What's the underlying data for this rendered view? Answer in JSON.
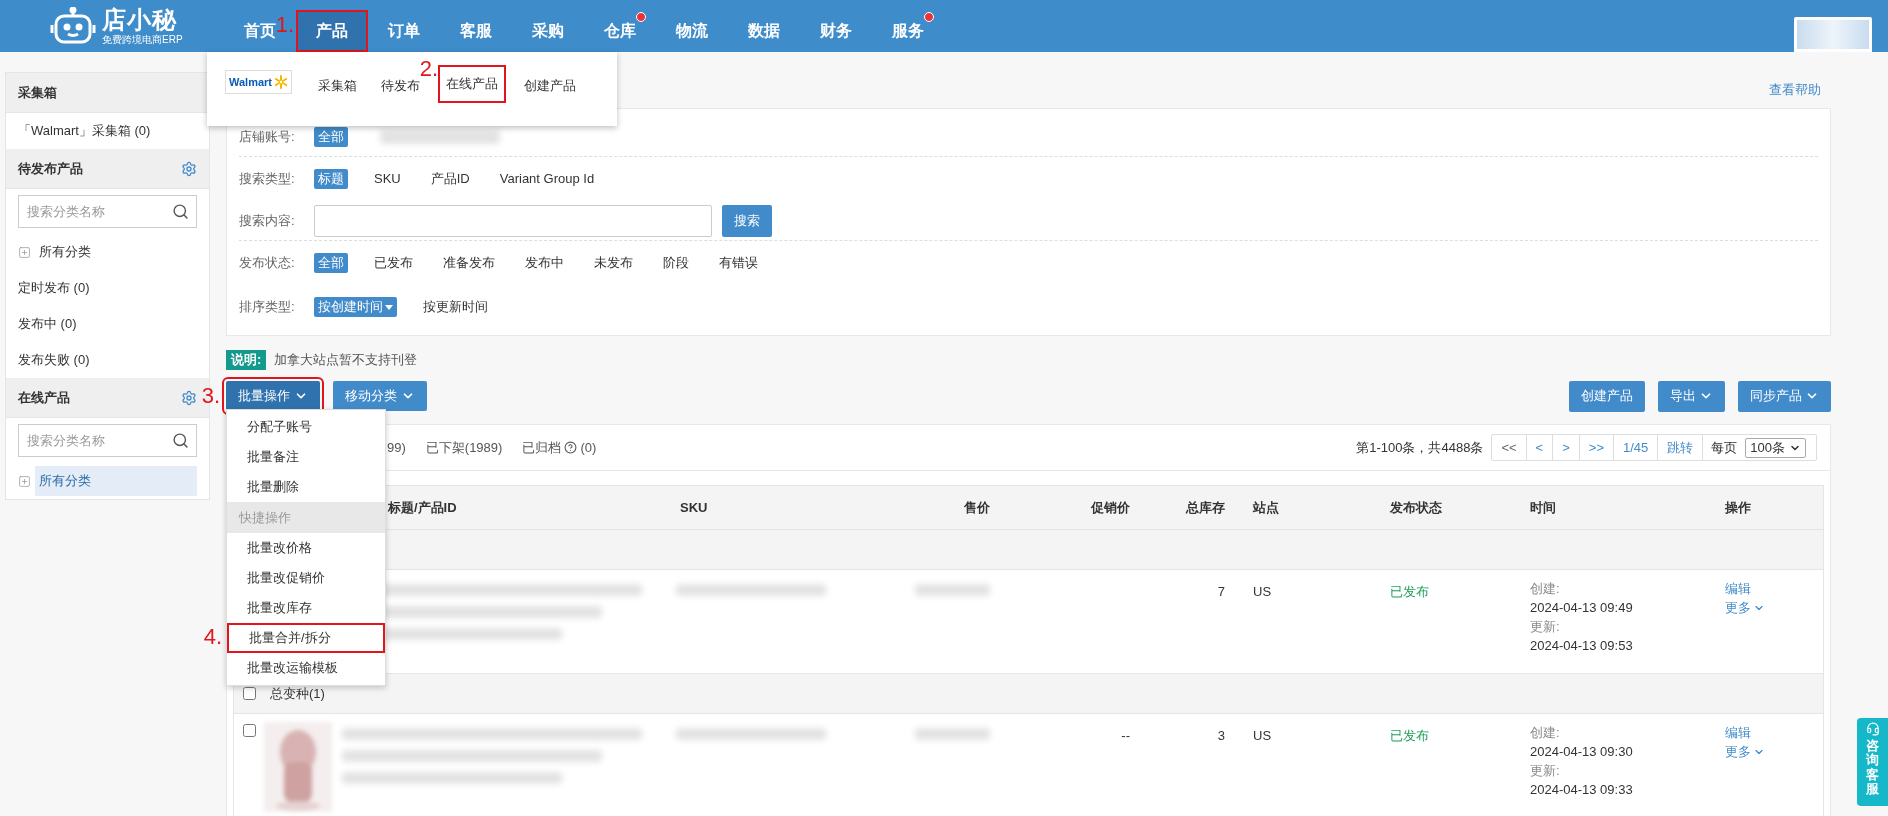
{
  "header": {
    "logo": {
      "name": "店小秘",
      "tagline": "免费跨境电商ERP"
    },
    "nav": [
      {
        "label": "首页",
        "selected": false,
        "badge": false,
        "highlighted": false
      },
      {
        "label": "产品",
        "selected": true,
        "badge": false,
        "highlighted": true,
        "annotation": "1."
      },
      {
        "label": "订单",
        "selected": false,
        "badge": false,
        "highlighted": false
      },
      {
        "label": "客服",
        "selected": false,
        "badge": false,
        "highlighted": false
      },
      {
        "label": "采购",
        "selected": false,
        "badge": false,
        "highlighted": false
      },
      {
        "label": "仓库",
        "selected": false,
        "badge": true,
        "highlighted": false
      },
      {
        "label": "物流",
        "selected": false,
        "badge": false,
        "highlighted": false
      },
      {
        "label": "数据",
        "selected": false,
        "badge": false,
        "highlighted": false
      },
      {
        "label": "财务",
        "selected": false,
        "badge": false,
        "highlighted": false
      },
      {
        "label": "服务",
        "selected": false,
        "badge": true,
        "highlighted": false
      }
    ]
  },
  "product_menu": {
    "brand": "Walmart",
    "items": [
      {
        "label": "采集箱",
        "highlighted": false
      },
      {
        "label": "待发布",
        "highlighted": false
      },
      {
        "label": "在线产品",
        "highlighted": true,
        "annotation": "2."
      },
      {
        "label": "创建产品",
        "highlighted": false
      }
    ]
  },
  "sidebar": {
    "sections": [
      {
        "title": "采集箱",
        "settings": false,
        "items": [
          {
            "kind": "link",
            "label": "「Walmart」采集箱 (0)",
            "selected": false
          }
        ]
      },
      {
        "title": "待发布产品",
        "settings": true,
        "items": [
          {
            "kind": "search",
            "placeholder": "搜索分类名称"
          },
          {
            "kind": "tree",
            "label": "所有分类",
            "selected": false
          },
          {
            "kind": "link",
            "label": "定时发布 (0)",
            "selected": false
          },
          {
            "kind": "link",
            "label": "发布中 (0)",
            "selected": false
          },
          {
            "kind": "link",
            "label": "发布失败 (0)",
            "selected": false
          }
        ]
      },
      {
        "title": "在线产品",
        "settings": true,
        "items": [
          {
            "kind": "search",
            "placeholder": "搜索分类名称"
          },
          {
            "kind": "tree",
            "label": "所有分类",
            "selected": true
          }
        ]
      }
    ]
  },
  "help_link": "查看帮助",
  "filters": [
    {
      "kind": "options",
      "label": "店铺账号:",
      "options": [
        {
          "label": "全部",
          "selected": true
        }
      ]
    },
    {
      "kind": "options",
      "label": "搜索类型:",
      "options": [
        {
          "label": "标题",
          "selected": true
        },
        {
          "label": "SKU",
          "selected": false
        },
        {
          "label": "产品ID",
          "selected": false
        },
        {
          "label": "Variant Group Id",
          "selected": false
        }
      ]
    },
    {
      "kind": "input",
      "label": "搜索内容:",
      "button": "搜索"
    },
    {
      "kind": "options",
      "label": "发布状态:",
      "options": [
        {
          "label": "全部",
          "selected": true
        },
        {
          "label": "已发布",
          "selected": false
        },
        {
          "label": "准备发布",
          "selected": false
        },
        {
          "label": "发布中",
          "selected": false
        },
        {
          "label": "未发布",
          "selected": false
        },
        {
          "label": "阶段",
          "selected": false
        },
        {
          "label": "有错误",
          "selected": false
        }
      ]
    },
    {
      "kind": "options",
      "label": "排序类型:",
      "options": [
        {
          "label": "按创建时间",
          "selected": true,
          "dropdown": true
        },
        {
          "label": "按更新时间",
          "selected": false,
          "dropdown": false
        }
      ]
    }
  ],
  "notice": {
    "tag": "说明:",
    "text": "加拿大站点暂不支持刊登"
  },
  "toolbar": {
    "left": [
      {
        "label": "批量操作",
        "highlighted": true,
        "annotation": "3.",
        "caret": true
      },
      {
        "label": "移动分类",
        "highlighted": false,
        "caret": true
      }
    ],
    "right": [
      {
        "label": "创建产品",
        "caret": false
      },
      {
        "label": "导出",
        "caret": true
      },
      {
        "label": "同步产品",
        "caret": true
      }
    ]
  },
  "batch_menu": {
    "items": [
      {
        "kind": "item",
        "label": "分配子账号",
        "highlighted": false
      },
      {
        "kind": "item",
        "label": "批量备注",
        "highlighted": false
      },
      {
        "kind": "item",
        "label": "批量删除",
        "highlighted": false
      },
      {
        "kind": "header",
        "label": "快捷操作"
      },
      {
        "kind": "item",
        "label": "批量改价格",
        "highlighted": false
      },
      {
        "kind": "item",
        "label": "批量改促销价",
        "highlighted": false
      },
      {
        "kind": "item",
        "label": "批量改库存",
        "highlighted": false
      },
      {
        "kind": "item",
        "label": "批量合并/拆分",
        "highlighted": true,
        "annotation": "4."
      },
      {
        "kind": "item",
        "label": "批量改运输模板",
        "highlighted": false
      }
    ]
  },
  "tabs": [
    {
      "label": "99)",
      "help": false,
      "selected": false
    },
    {
      "label": "已下架(1989)",
      "help": false,
      "selected": false
    },
    {
      "label": "已归档",
      "help": true,
      "count": "(0)",
      "selected": false
    }
  ],
  "pagination": {
    "summary": "第1-100条，共4488条",
    "buttons": [
      "<<",
      "<",
      ">",
      ">>",
      "1/45",
      "跳转"
    ],
    "per_page_label": "每页",
    "per_page": "100条"
  },
  "table": {
    "columns": [
      "标题/产品ID",
      "SKU",
      "售价",
      "促销价",
      "总库存",
      "站点",
      "发布状态",
      "时间",
      "操作"
    ],
    "rows": [
      {
        "kind": "group"
      },
      {
        "kind": "product",
        "stock": "7",
        "site": "US",
        "status": "已发布",
        "created_label": "创建:",
        "created": "2024-04-13 09:49",
        "updated_label": "更新:",
        "updated": "2024-04-13 09:53",
        "actions": [
          "编辑",
          "更多"
        ]
      },
      {
        "kind": "group",
        "checked": false,
        "label": "总变种(1)"
      },
      {
        "kind": "product",
        "checked": false,
        "thumbnail": {
          "kind": "picture"
        },
        "promo": "--",
        "stock": "3",
        "site": "US",
        "status": "已发布",
        "created_label": "创建:",
        "created": "2024-04-13 09:30",
        "updated_label": "更新:",
        "updated": "2024-04-13 09:33",
        "actions": [
          "编辑",
          "更多"
        ]
      }
    ]
  },
  "float_button": {
    "label": "咨询客服"
  }
}
